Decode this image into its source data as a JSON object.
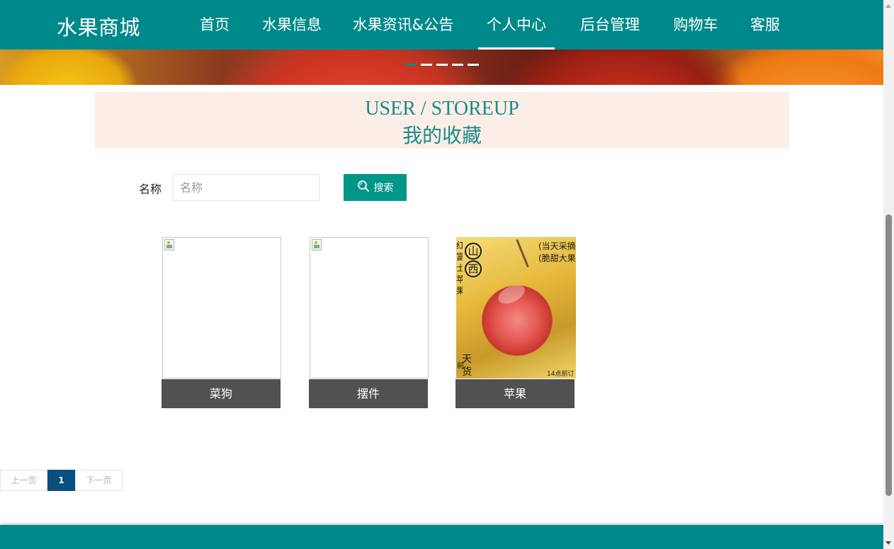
{
  "header": {
    "brand": "水果商城",
    "nav": [
      {
        "label": "首页"
      },
      {
        "label": "水果信息"
      },
      {
        "label": "水果资讯&公告"
      },
      {
        "label": "个人中心",
        "active": true
      },
      {
        "label": "后台管理"
      },
      {
        "label": "购物车"
      },
      {
        "label": "客服"
      }
    ],
    "accent_color": "#00898a"
  },
  "banner": {
    "slides": 5,
    "active_slide": 1
  },
  "section": {
    "title_en": "USER / STOREUP",
    "title_cn": "我的收藏"
  },
  "search": {
    "label": "名称",
    "placeholder": "名称",
    "value": "",
    "button_label": "搜索",
    "button_icon": "search-icon",
    "button_color": "#009688"
  },
  "favorites": [
    {
      "name": "菜狗",
      "image": "broken-image"
    },
    {
      "name": "摆件",
      "image": "broken-image"
    },
    {
      "name": "苹果",
      "image": "apple-photo",
      "image_text": {
        "seal_1": "山",
        "seal_2": "西",
        "line_1": "(当天采摘",
        "line_2": "(脆甜大果",
        "side_strip": "红富士苹果",
        "bottom_1": "天",
        "bottom_2": "货",
        "bottom_left": "前",
        "corner": "14点前订"
      }
    }
  ],
  "pager": {
    "prev_label": "上一页",
    "current": "1",
    "next_label": "下一页",
    "active_color": "#0a4f7e"
  }
}
